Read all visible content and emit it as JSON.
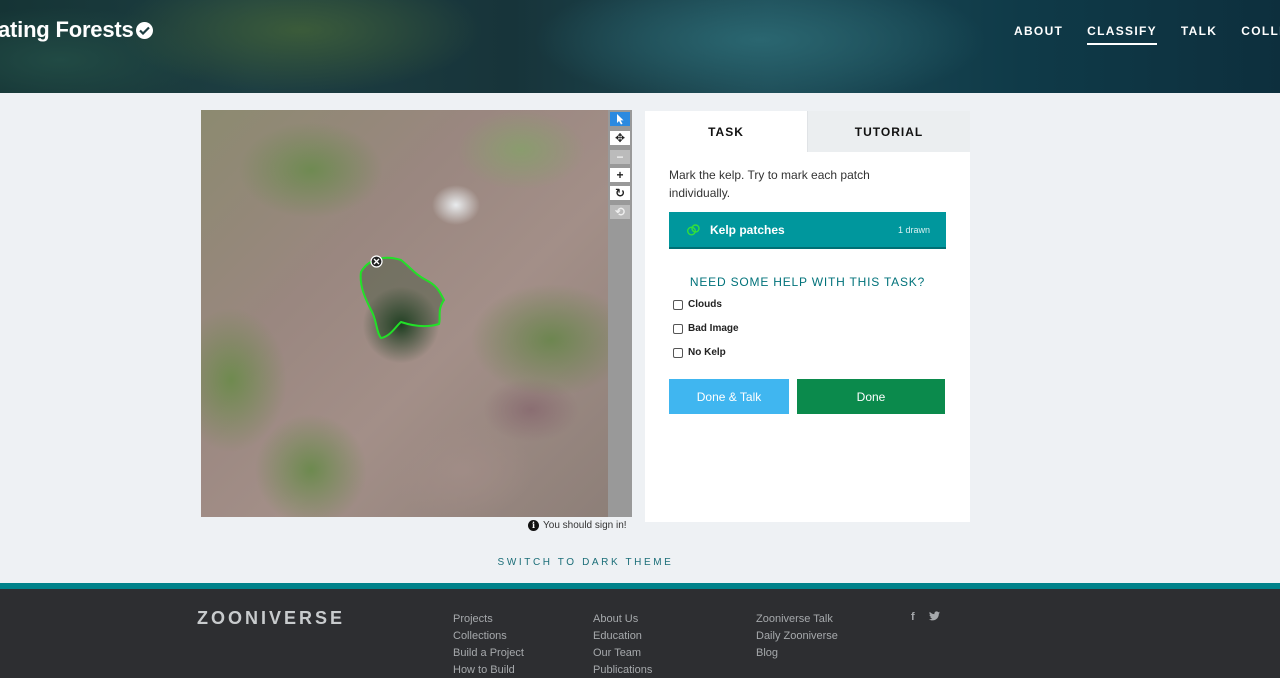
{
  "header": {
    "project_title": "ating Forests",
    "nav": [
      "ABOUT",
      "CLASSIFY",
      "TALK",
      "COLLECT"
    ],
    "active_nav": "CLASSIFY"
  },
  "viewer": {
    "tools": [
      "pointer-icon",
      "move-icon",
      "zoom-out-icon",
      "zoom-in-icon",
      "rotate-icon",
      "reset-icon"
    ],
    "sign_in_notice": "You should sign in!"
  },
  "task": {
    "tabs": {
      "task": "TASK",
      "tutorial": "TUTORIAL"
    },
    "instruction": "Mark the kelp. Try to mark each patch individually.",
    "tool_label": "Kelp patches",
    "tool_count": "1 drawn",
    "help_link": "NEED SOME HELP WITH THIS TASK?",
    "checkboxes": [
      "Clouds",
      "Bad Image",
      "No Kelp"
    ],
    "done_talk": "Done & Talk",
    "done": "Done"
  },
  "theme_toggle": "SWITCH TO DARK THEME",
  "footer": {
    "logo": "ZOONIVERSE",
    "col1": [
      "Projects",
      "Collections",
      "Build a Project",
      "How to Build"
    ],
    "col2": [
      "About Us",
      "Education",
      "Our Team",
      "Publications"
    ],
    "col3": [
      "Zooniverse Talk",
      "Daily Zooniverse",
      "Blog"
    ],
    "social": [
      "f",
      "twitter-icon"
    ]
  },
  "colors": {
    "accent": "#00979d",
    "done_green": "#0b8a4c",
    "done_talk_blue": "#40b6f0",
    "outline_green": "#22e028"
  }
}
